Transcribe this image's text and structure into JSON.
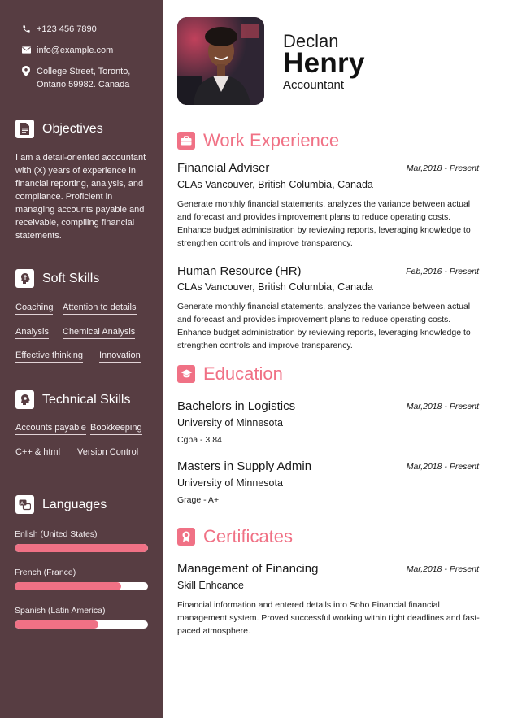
{
  "contact": {
    "phone": "+123 456 7890",
    "email": "info@example.com",
    "address_line1": "College Street, Toronto,",
    "address_line2": "Ontario 59982. Canada"
  },
  "objectives": {
    "title": "Objectives",
    "text": "I am a detail-oriented accountant with (X) years of experience in financial reporting, analysis, and compliance. Proficient in managing accounts payable and receivable, compiling financial statements."
  },
  "soft_skills": {
    "title": "Soft Skills",
    "items": [
      "Coaching",
      "Attention to details",
      "Analysis",
      "Chemical Analysis",
      "Effective thinking",
      "Innovation"
    ]
  },
  "technical_skills": {
    "title": "Technical Skills",
    "items": [
      "Accounts payable",
      "Bookkeeping",
      "C++ & html",
      "Version Control"
    ]
  },
  "languages": {
    "title": "Languages",
    "items": [
      {
        "name": "Enlish (United States)",
        "level": 1.0
      },
      {
        "name": "French (France)",
        "level": 0.8
      },
      {
        "name": "Spanish (Latin America)",
        "level": 0.63
      }
    ]
  },
  "header": {
    "first_name": "Declan",
    "last_name": "Henry",
    "role": "Accountant"
  },
  "work": {
    "title": "Work Experience",
    "jobs": [
      {
        "title": "Financial Adviser",
        "date": "Mar,2018 - Present",
        "org": "CLAs Vancouver, British Columbia, Canada",
        "desc": "Generate monthly financial statements, analyzes the variance between actual and forecast and provides improvement plans to reduce operating costs. Enhance budget administration by reviewing reports, leveraging knowledge to strengthen controls and improve transparency."
      },
      {
        "title": "Human Resource (HR)",
        "date": "Feb,2016 - Present",
        "org": "CLAs Vancouver, British Columbia, Canada",
        "desc": "Generate monthly financial statements, analyzes the variance between actual and forecast and provides improvement plans to reduce operating costs. Enhance budget administration by reviewing reports, leveraging knowledge to strengthen controls and improve transparency."
      }
    ]
  },
  "education": {
    "title": "Education",
    "items": [
      {
        "degree": "Bachelors in Logistics",
        "date": "Mar,2018 - Present",
        "school": "University of Minnesota",
        "grade": "Cgpa - 3.84"
      },
      {
        "degree": "Masters in Supply Admin",
        "date": "Mar,2018 - Present",
        "school": "University of Minnesota",
        "grade": "Grage - A+"
      }
    ]
  },
  "certificates": {
    "title": "Certificates",
    "items": [
      {
        "name": "Management of Financing",
        "date": "Mar,2018 - Present",
        "issuer": "Skill Enhcance",
        "desc": "Financial information and entered details into Soho Financial financial management system. Proved successful working within tight deadlines and fast-paced atmosphere."
      }
    ]
  },
  "colors": {
    "sidebar": "#573d42",
    "accent": "#f07185"
  }
}
